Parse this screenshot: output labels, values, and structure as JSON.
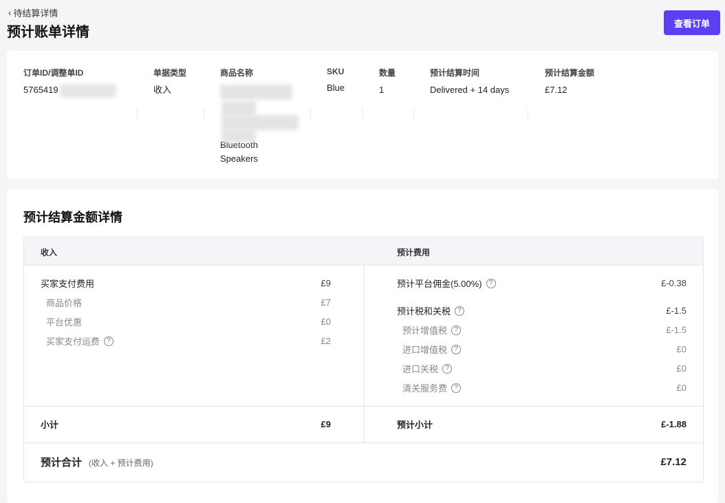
{
  "header": {
    "back_label": "待结算详情",
    "title": "预计账单详情",
    "view_order_button": "查看订单"
  },
  "summary": {
    "columns": [
      {
        "header": "订单ID/调整单ID",
        "value": "5765419"
      },
      {
        "header": "单据类型",
        "value": "收入"
      },
      {
        "header": "商品名称",
        "value_lines": [
          "Bluetooth",
          "Speakers"
        ]
      },
      {
        "header": "SKU",
        "value": "Blue"
      },
      {
        "header": "数量",
        "value": "1"
      },
      {
        "header": "预计结算时间",
        "value": "Delivered + 14 days"
      },
      {
        "header": "预计结算金额",
        "value": "£7.12"
      }
    ]
  },
  "details": {
    "title": "预计结算金额详情",
    "income_header": "收入",
    "fees_header": "预计费用",
    "income_rows": [
      {
        "label": "买家支付费用",
        "value": "£9",
        "sub": false,
        "help": false
      },
      {
        "label": "商品价格",
        "value": "£7",
        "sub": true,
        "help": false
      },
      {
        "label": "平台优惠",
        "value": "£0",
        "sub": true,
        "help": false
      },
      {
        "label": "买家支付运费",
        "value": "£2",
        "sub": true,
        "help": true
      }
    ],
    "fee_rows": [
      {
        "label": "预计平台佣金(5.00%)",
        "value": "£-0.38",
        "sub": false,
        "help": true
      },
      {
        "label": "预计税和关税",
        "value": "£-1.5",
        "sub": false,
        "help": true
      },
      {
        "label": "预计增值税",
        "value": "£-1.5",
        "sub": true,
        "help": true
      },
      {
        "label": "进口增值税",
        "value": "£0",
        "sub": true,
        "help": true
      },
      {
        "label": "进口关税",
        "value": "£0",
        "sub": true,
        "help": true
      },
      {
        "label": "清关服务费",
        "value": "£0",
        "sub": true,
        "help": true
      }
    ],
    "income_subtotal_label": "小计",
    "income_subtotal_value": "£9",
    "fee_subtotal_label": "预计小计",
    "fee_subtotal_value": "£-1.88",
    "total_label": "预计合计",
    "total_note": "(收入 + 预计费用)",
    "total_value": "£7.12"
  },
  "icons": {
    "back": "chevron-left-icon",
    "help": "question-circle-icon"
  },
  "colors": {
    "accent": "#5b3ff2",
    "background": "#f5f5f7",
    "muted_text": "#888888"
  }
}
